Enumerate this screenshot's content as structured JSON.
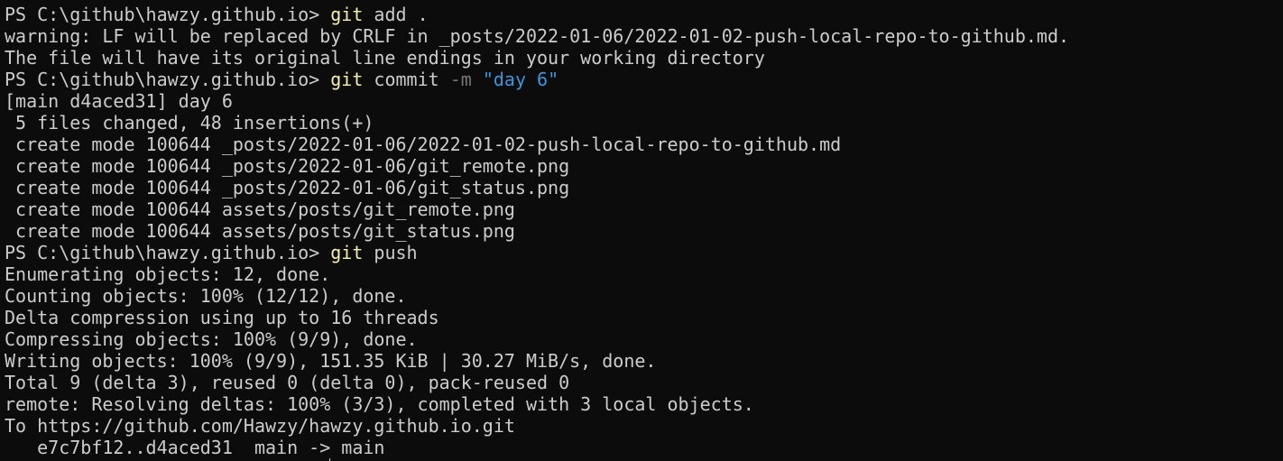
{
  "terminal": {
    "lines": [
      [
        {
          "t": "PS C:\\github\\hawzy.github.io> ",
          "k": "text"
        },
        {
          "t": "git",
          "k": "cmd"
        },
        {
          "t": " add .",
          "k": "text"
        }
      ],
      [
        {
          "t": "warning: LF will be replaced by CRLF in _posts/2022-01-06/2022-01-02-push-local-repo-to-github.md.",
          "k": "text"
        }
      ],
      [
        {
          "t": "The file will have its original line endings in your working directory",
          "k": "text"
        }
      ],
      [
        {
          "t": "PS C:\\github\\hawzy.github.io> ",
          "k": "text"
        },
        {
          "t": "git",
          "k": "cmd"
        },
        {
          "t": " commit ",
          "k": "text"
        },
        {
          "t": "-m",
          "k": "flag"
        },
        {
          "t": " ",
          "k": "text"
        },
        {
          "t": "\"day 6\"",
          "k": "str"
        }
      ],
      [
        {
          "t": "[main d4aced31] day 6",
          "k": "text"
        }
      ],
      [
        {
          "t": " 5 files changed, 48 insertions(+)",
          "k": "text"
        }
      ],
      [
        {
          "t": " create mode 100644 _posts/2022-01-06/2022-01-02-push-local-repo-to-github.md",
          "k": "text"
        }
      ],
      [
        {
          "t": " create mode 100644 _posts/2022-01-06/git_remote.png",
          "k": "text"
        }
      ],
      [
        {
          "t": " create mode 100644 _posts/2022-01-06/git_status.png",
          "k": "text"
        }
      ],
      [
        {
          "t": " create mode 100644 assets/posts/git_remote.png",
          "k": "text"
        }
      ],
      [
        {
          "t": " create mode 100644 assets/posts/git_status.png",
          "k": "text"
        }
      ],
      [
        {
          "t": "PS C:\\github\\hawzy.github.io> ",
          "k": "text"
        },
        {
          "t": "git",
          "k": "cmd"
        },
        {
          "t": " push",
          "k": "text"
        }
      ],
      [
        {
          "t": "Enumerating objects: 12, done.",
          "k": "text"
        }
      ],
      [
        {
          "t": "Counting objects: 100% (12/12), done.",
          "k": "text"
        }
      ],
      [
        {
          "t": "Delta compression using up to 16 threads",
          "k": "text"
        }
      ],
      [
        {
          "t": "Compressing objects: 100% (9/9), done.",
          "k": "text"
        }
      ],
      [
        {
          "t": "Writing objects: 100% (9/9), 151.35 KiB | 30.27 MiB/s, done.",
          "k": "text"
        }
      ],
      [
        {
          "t": "Total 9 (delta 3), reused 0 (delta 0), pack-reused 0",
          "k": "text"
        }
      ],
      [
        {
          "t": "remote: Resolving deltas: 100% (3/3), completed with 3 local objects.",
          "k": "text"
        }
      ],
      [
        {
          "t": "To https://github.com/Hawzy/hawzy.github.io.git",
          "k": "text"
        }
      ],
      [
        {
          "t": "   e7c7bf12..d4aced31  main -> main",
          "k": "text"
        }
      ]
    ]
  },
  "colors": {
    "background": "#0c0c0c",
    "foreground": "#cccccc",
    "command": "#f9f1a5",
    "flag": "#767676",
    "string": "#3a96dd"
  }
}
